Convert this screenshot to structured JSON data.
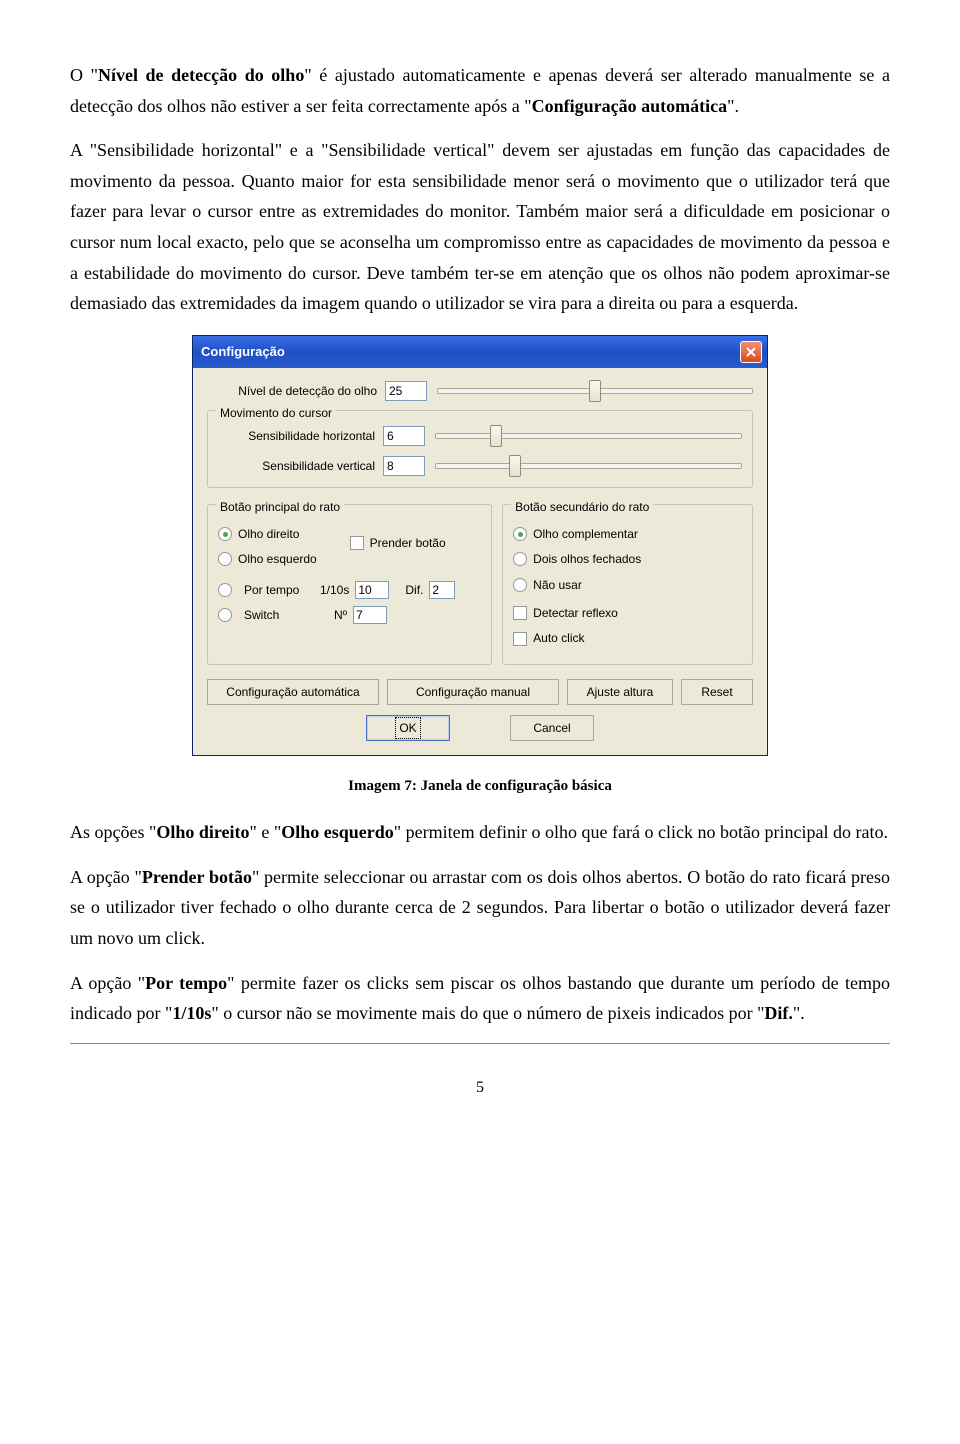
{
  "para1": {
    "p1_a": "O \"",
    "p1_b": "Nível de detecção do olho",
    "p1_c": "\" é ajustado automaticamente e apenas deverá ser alterado manualmente se a detecção dos olhos não estiver a ser feita correctamente após a \"",
    "p1_d": "Configuração automática",
    "p1_e": "\"."
  },
  "para2": "A \"Sensibilidade horizontal\" e a \"Sensibilidade vertical\" devem ser ajustadas em função das capacidades de movimento da pessoa. Quanto maior for esta sensibilidade menor será o movimento que o utilizador terá que fazer para levar o cursor entre as extremidades do monitor. Também maior será a dificuldade em posicionar o cursor num local exacto, pelo que se aconselha um compromisso entre as capacidades de movimento da pessoa e a estabilidade do movimento do cursor. Deve também ter-se em atenção que os olhos não podem aproximar-se demasiado das extremidades da imagem quando o utilizador se vira para a direita ou para a esquerda.",
  "caption": "Imagem 7: Janela de configuração básica",
  "para3": {
    "a": "As opções \"",
    "b": "Olho direito",
    "c": "\" e \"",
    "d": "Olho esquerdo",
    "e": "\" permitem definir o olho que fará o click no botão principal do rato."
  },
  "para4": {
    "a": "A opção \"",
    "b": "Prender botão",
    "c": "\" permite seleccionar ou arrastar com os dois olhos abertos. O botão do rato ficará preso se o utilizador tiver fechado o olho durante cerca de 2 segundos. Para libertar o botão o utilizador deverá fazer um novo um click."
  },
  "para5": {
    "a": "A opção \"",
    "b": "Por tempo",
    "c": "\" permite fazer os clicks sem piscar os olhos bastando que durante um período de tempo indicado por \"",
    "d": "1/10s",
    "e": "\" o cursor não se movimente mais do que o número de pixeis indicados por \"",
    "f": "Dif.",
    "g": "\"."
  },
  "dialog": {
    "title": "Configuração",
    "lbl_nivel": "Nível de detecção do olho",
    "val_nivel": "25",
    "grp_mov": "Movimento do cursor",
    "lbl_sh": "Sensibilidade horizontal",
    "val_sh": "6",
    "lbl_sv": "Sensibilidade vertical",
    "val_sv": "8",
    "grp_primary": "Botão principal do rato",
    "opt_direito": "Olho direito",
    "opt_esquerdo": "Olho esquerdo",
    "chk_prender": "Prender botão",
    "opt_portempo": "Por tempo",
    "lbl_110s": "1/10s",
    "val_110s": "10",
    "lbl_dif": "Dif.",
    "val_dif": "2",
    "opt_switch": "Switch",
    "lbl_no": "Nº",
    "val_no": "7",
    "grp_secondary": "Botão secundário do rato",
    "opt_complementar": "Olho complementar",
    "opt_doisolhos": "Dois olhos fechados",
    "opt_naousar": "Não usar",
    "chk_reflexo": "Detectar reflexo",
    "chk_autoclick": "Auto click",
    "btn_auto": "Configuração automática",
    "btn_manual": "Configuração manual",
    "btn_altura": "Ajuste altura",
    "btn_reset": "Reset",
    "btn_ok": "OK",
    "btn_cancel": "Cancel"
  },
  "page_number": "5"
}
